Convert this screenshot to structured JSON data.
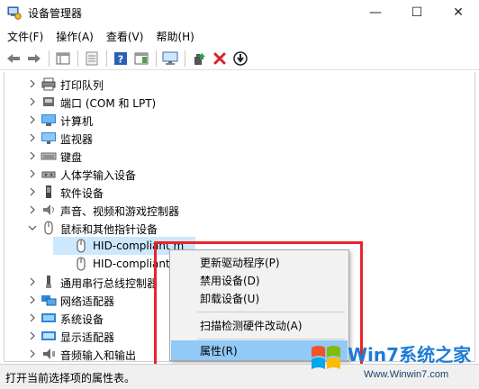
{
  "window": {
    "title": "设备管理器",
    "controls": {
      "minimize": "—",
      "maximize": "☐",
      "close": "✕"
    }
  },
  "menubar": [
    "文件(F)",
    "操作(A)",
    "查看(V)",
    "帮助(H)"
  ],
  "toolbar": [
    "back-icon",
    "forward-icon",
    "show-hide-console-tree-icon",
    "properties-icon",
    "help-icon",
    "action-pane-icon",
    "computer-monitor-icon",
    "update-driver-icon",
    "uninstall-icon",
    "download-driver-icon"
  ],
  "tree": {
    "items": [
      {
        "label": "打印队列",
        "icon": "printer-icon",
        "expanded": false
      },
      {
        "label": "端口 (COM 和 LPT)",
        "icon": "port-icon",
        "expanded": false
      },
      {
        "label": "计算机",
        "icon": "computer-icon",
        "expanded": false
      },
      {
        "label": "监视器",
        "icon": "monitor-icon",
        "expanded": false
      },
      {
        "label": "键盘",
        "icon": "keyboard-icon",
        "expanded": false
      },
      {
        "label": "人体学输入设备",
        "icon": "hid-icon",
        "expanded": false
      },
      {
        "label": "软件设备",
        "icon": "software-device-icon",
        "expanded": false
      },
      {
        "label": "声音、视频和游戏控制器",
        "icon": "speaker-icon",
        "expanded": false
      },
      {
        "label": "鼠标和其他指针设备",
        "icon": "mouse-icon",
        "expanded": true
      },
      {
        "label": "HID-compliant m",
        "icon": "mouse-icon",
        "child": true,
        "selected": true
      },
      {
        "label": "HID-compliant m",
        "icon": "mouse-icon",
        "child": true
      },
      {
        "label": "通用串行总线控制器",
        "icon": "usb-icon",
        "expanded": false
      },
      {
        "label": "网络适配器",
        "icon": "network-icon",
        "expanded": false
      },
      {
        "label": "系统设备",
        "icon": "system-device-icon",
        "expanded": false
      },
      {
        "label": "显示适配器",
        "icon": "display-adapter-icon",
        "expanded": false
      },
      {
        "label": "音频输入和输出",
        "icon": "audio-icon",
        "expanded": false
      }
    ]
  },
  "context_menu": {
    "items": [
      {
        "label": "更新驱动程序(P)"
      },
      {
        "label": "禁用设备(D)"
      },
      {
        "label": "卸载设备(U)"
      },
      {
        "label": "扫描检测硬件改动(A)"
      },
      {
        "label": "属性(R)",
        "highlighted": true
      }
    ]
  },
  "statusbar": {
    "text": "打开当前选择项的属性表。"
  },
  "watermark": {
    "logo_text": "Win7系统之家",
    "url": "Www.Winwin7.com"
  },
  "colors": {
    "highlight": "#91c9f7",
    "selection": "#cce8ff",
    "annotation_red": "#e8252c"
  }
}
